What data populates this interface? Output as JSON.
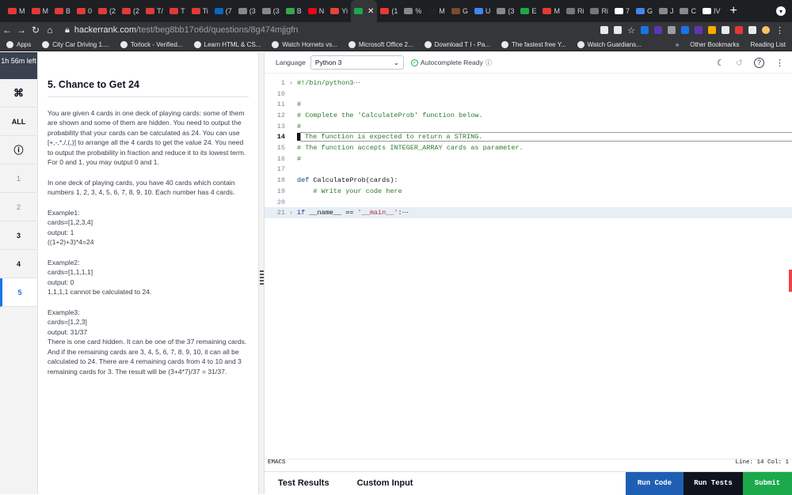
{
  "browser": {
    "tabs": [
      {
        "label": "M",
        "color": "#e53935"
      },
      {
        "label": "M",
        "color": "#e53935"
      },
      {
        "label": "B",
        "color": "#e53935"
      },
      {
        "label": "0",
        "color": "#e53935"
      },
      {
        "label": "(2",
        "color": "#e53935"
      },
      {
        "label": "(2",
        "color": "#e53935"
      },
      {
        "label": "T/",
        "color": "#e53935"
      },
      {
        "label": "T",
        "color": "#e53935"
      },
      {
        "label": "Ti",
        "color": "#e53935"
      },
      {
        "label": "(7",
        "color": "#0a66c2"
      },
      {
        "label": "(3",
        "color": "#888"
      },
      {
        "label": "(3",
        "color": "#888"
      },
      {
        "label": "B",
        "color": "#34a853"
      },
      {
        "label": "N",
        "color": "#e50914"
      },
      {
        "label": "Yi",
        "color": "#ea4335"
      },
      {
        "label": "",
        "color": "#1ba94c",
        "active": true
      },
      {
        "label": "(1",
        "color": "#e53935"
      },
      {
        "label": "%",
        "color": "#888"
      },
      {
        "label": "M",
        "color": "#222"
      },
      {
        "label": "G",
        "color": "#7a4a2a"
      },
      {
        "label": "U",
        "color": "#4285f4"
      },
      {
        "label": "(3",
        "color": "#888"
      },
      {
        "label": "E",
        "color": "#1ba94c"
      },
      {
        "label": "M",
        "color": "#e53935"
      },
      {
        "label": "Ri",
        "color": "#777"
      },
      {
        "label": "Ri",
        "color": "#777"
      },
      {
        "label": "7",
        "color": "#fff"
      },
      {
        "label": "G",
        "color": "#4285f4"
      },
      {
        "label": "J",
        "color": "#888"
      },
      {
        "label": "C",
        "color": "#888"
      },
      {
        "label": "IV",
        "color": "#fff"
      }
    ],
    "new_tab": "+",
    "url_host": "hackerrank.com",
    "url_path": "/test/beg8bb17o6d/questions/8g474mjjgfn",
    "bookmarks": [
      "Apps",
      "City Car Driving 1....",
      "Torlock - Verified...",
      "Learn HTML & CS...",
      "Watch Hornets vs...",
      "Microsoft Office 2...",
      "Download T I - Pa...",
      "The fastest free Y...",
      "Watch Guardians..."
    ],
    "bookmarks_more": "»",
    "other_bookmarks": "Other Bookmarks",
    "reading_list": "Reading List"
  },
  "sidebar": {
    "timer": "1h 56m left",
    "items": [
      "⌘",
      "ALL",
      "ⓘ",
      "1",
      "2",
      "3",
      "4",
      "5"
    ]
  },
  "problem": {
    "title": "5. Chance to Get 24",
    "p1": "You are given 4 cards in one deck of playing cards: some of them are shown and some of them are hidden. You need to output the probability that your cards can be calculated as 24. You can use [+,-,*,/,(,)] to arrange all the 4 cards to get the value 24. You need to output the probability in fraction and reduce it to its lowest term. For 0 and 1, you may output 0 and 1.",
    "p2": "In one deck of playing cards, you have 40 cards which contain numbers 1, 2, 3, 4, 5, 6, 7, 8, 9, 10. Each number has 4 cards.",
    "ex1": [
      "Example1:",
      "cards=[1,2,3,4]",
      "output: 1",
      "((1+2)+3)*4=24"
    ],
    "ex2": [
      "Example2:",
      "cards=[1,1,1,1]",
      "output: 0",
      "1,1,1,1 cannot be calculated to 24."
    ],
    "ex3": [
      "Example3:",
      "cards=[1,2,3]",
      "output: 31/37"
    ],
    "ex3_text": "There is one card hidden. It can be one of the 37 remaining cards. And if the remaining cards are 3, 4, 5, 6, 7, 8, 9, 10, it can all be calculated to 24. There are 4 remaining cards from 4 to 10 and 3 remaining cards for 3. The result will be (3+4*7)/37 = 31/37."
  },
  "editor": {
    "language_label": "Language",
    "language": "Python 3",
    "autocomplete": "Autocomplete Ready",
    "lines": [
      {
        "n": "1",
        "text": "#!/bin/python3⋯",
        "fold": "›"
      },
      {
        "n": "10",
        "text": ""
      },
      {
        "n": "11",
        "text": "#"
      },
      {
        "n": "12",
        "text": "# Complete the 'CalculateProb' function below."
      },
      {
        "n": "13",
        "text": "#"
      },
      {
        "n": "14",
        "text": " The function is expected to return a STRING."
      },
      {
        "n": "15",
        "text": "# The function accepts INTEGER_ARRAY cards as parameter."
      },
      {
        "n": "16",
        "text": "#"
      },
      {
        "n": "17",
        "text": ""
      },
      {
        "n": "18",
        "text": "def CalculateProb(cards):"
      },
      {
        "n": "19",
        "text": "    # Write your code here"
      },
      {
        "n": "20",
        "text": ""
      },
      {
        "n": "21",
        "text": "if __name__ == '__main__':⋯",
        "fold": "›"
      }
    ],
    "mode": "EMACS",
    "position": "Line: 14 Col: 1"
  },
  "bottom": {
    "tab_results": "Test Results",
    "tab_custom": "Custom Input",
    "run_code": "Run Code",
    "run_tests": "Run Tests",
    "submit": "Submit"
  }
}
